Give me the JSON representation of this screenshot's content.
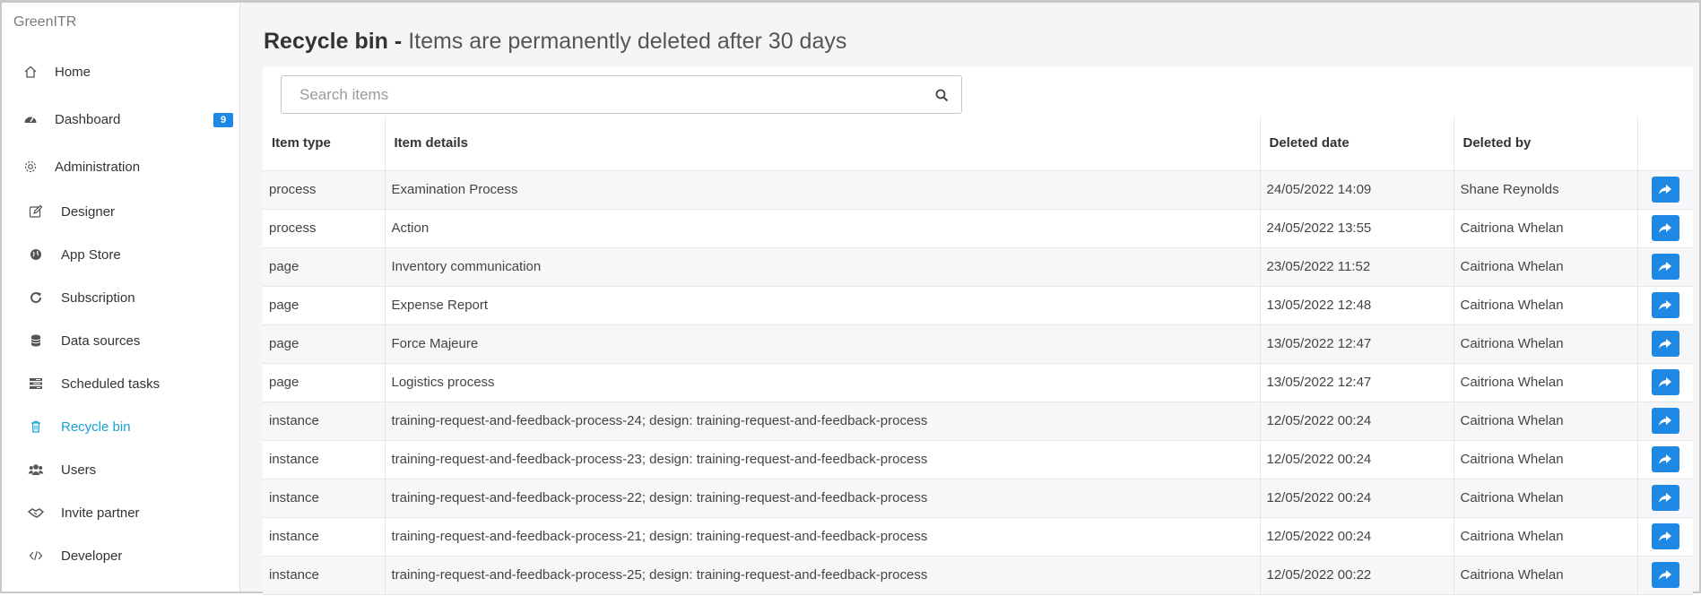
{
  "app": {
    "brand": "GreenITR"
  },
  "sidebar": {
    "items": [
      {
        "label": "Home",
        "icon": "home-icon"
      },
      {
        "label": "Dashboard",
        "icon": "dashboard-icon",
        "badge": "9"
      },
      {
        "label": "Administration",
        "icon": "gear-icon"
      },
      {
        "label": "Designer",
        "icon": "edit-icon"
      },
      {
        "label": "App Store",
        "icon": "globe-icon"
      },
      {
        "label": "Subscription",
        "icon": "refresh-icon"
      },
      {
        "label": "Data sources",
        "icon": "database-icon"
      },
      {
        "label": "Scheduled tasks",
        "icon": "tasks-icon"
      },
      {
        "label": "Recycle bin",
        "icon": "trash-icon",
        "active": true
      },
      {
        "label": "Users",
        "icon": "users-icon"
      },
      {
        "label": "Invite partner",
        "icon": "handshake-icon"
      },
      {
        "label": "Developer",
        "icon": "code-icon"
      }
    ]
  },
  "page": {
    "title_strong": "Recycle bin -",
    "title_light": "Items are permanently deleted after 30 days"
  },
  "search": {
    "placeholder": "Search items",
    "value": ""
  },
  "table": {
    "columns": [
      "Item type",
      "Item details",
      "Deleted date",
      "Deleted by",
      ""
    ],
    "rows": [
      {
        "type": "process",
        "details": "Examination Process",
        "date": "24/05/2022 14:09",
        "by": "Shane Reynolds"
      },
      {
        "type": "process",
        "details": "Action",
        "date": "24/05/2022 13:55",
        "by": "Caitriona Whelan"
      },
      {
        "type": "page",
        "details": "Inventory communication",
        "date": "23/05/2022 11:52",
        "by": "Caitriona Whelan"
      },
      {
        "type": "page",
        "details": "Expense Report",
        "date": "13/05/2022 12:48",
        "by": "Caitriona Whelan"
      },
      {
        "type": "page",
        "details": "Force Majeure",
        "date": "13/05/2022 12:47",
        "by": "Caitriona Whelan"
      },
      {
        "type": "page",
        "details": "Logistics process",
        "date": "13/05/2022 12:47",
        "by": "Caitriona Whelan"
      },
      {
        "type": "instance",
        "details": "training-request-and-feedback-process-24; design: training-request-and-feedback-process",
        "date": "12/05/2022 00:24",
        "by": "Caitriona Whelan"
      },
      {
        "type": "instance",
        "details": "training-request-and-feedback-process-23; design: training-request-and-feedback-process",
        "date": "12/05/2022 00:24",
        "by": "Caitriona Whelan"
      },
      {
        "type": "instance",
        "details": "training-request-and-feedback-process-22; design: training-request-and-feedback-process",
        "date": "12/05/2022 00:24",
        "by": "Caitriona Whelan"
      },
      {
        "type": "instance",
        "details": "training-request-and-feedback-process-21; design: training-request-and-feedback-process",
        "date": "12/05/2022 00:24",
        "by": "Caitriona Whelan"
      },
      {
        "type": "instance",
        "details": "training-request-and-feedback-process-25; design: training-request-and-feedback-process",
        "date": "12/05/2022 00:22",
        "by": "Caitriona Whelan"
      }
    ]
  },
  "colors": {
    "accent": "#1e88e5",
    "active_nav": "#17a2d6"
  }
}
